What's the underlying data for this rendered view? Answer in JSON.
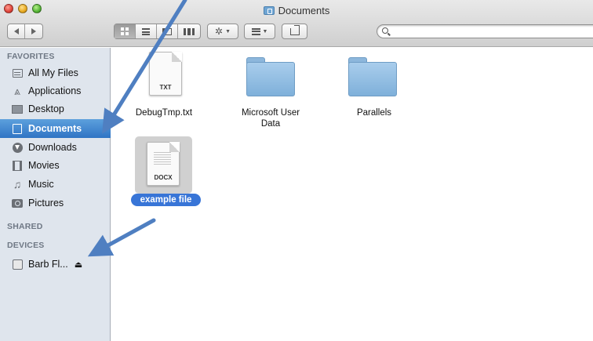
{
  "window": {
    "title": "Documents"
  },
  "toolbar": {
    "view_modes": [
      "icon-view",
      "list-view",
      "column-view",
      "cover-flow"
    ],
    "active_view": "icon-view",
    "search": {
      "value": "",
      "placeholder": ""
    }
  },
  "sidebar": {
    "sections": [
      {
        "title": "FAVORITES",
        "items": [
          {
            "label": "All My Files",
            "icon": "all-files-icon"
          },
          {
            "label": "Applications",
            "icon": "applications-icon"
          },
          {
            "label": "Desktop",
            "icon": "desktop-icon"
          },
          {
            "label": "Documents",
            "icon": "documents-icon",
            "selected": true
          },
          {
            "label": "Downloads",
            "icon": "downloads-icon"
          },
          {
            "label": "Movies",
            "icon": "movies-icon"
          },
          {
            "label": "Music",
            "icon": "music-icon"
          },
          {
            "label": "Pictures",
            "icon": "pictures-icon"
          }
        ]
      },
      {
        "title": "SHARED",
        "items": []
      },
      {
        "title": "DEVICES",
        "items": [
          {
            "label": "Barb Fl...",
            "icon": "drive-icon",
            "eject": "⏏"
          }
        ]
      }
    ]
  },
  "files": [
    {
      "name": "DebugTmp.txt",
      "type": "document",
      "ext": "TXT"
    },
    {
      "name": "Microsoft User Data",
      "type": "folder"
    },
    {
      "name": "Parallels",
      "type": "folder"
    },
    {
      "name": "example file",
      "type": "document",
      "ext": "DOCX",
      "selected": true
    }
  ],
  "colors": {
    "selection": "#3875d7",
    "sidebar_bg": "#dfe5ed",
    "annotation_arrow": "#4f7fc1"
  }
}
